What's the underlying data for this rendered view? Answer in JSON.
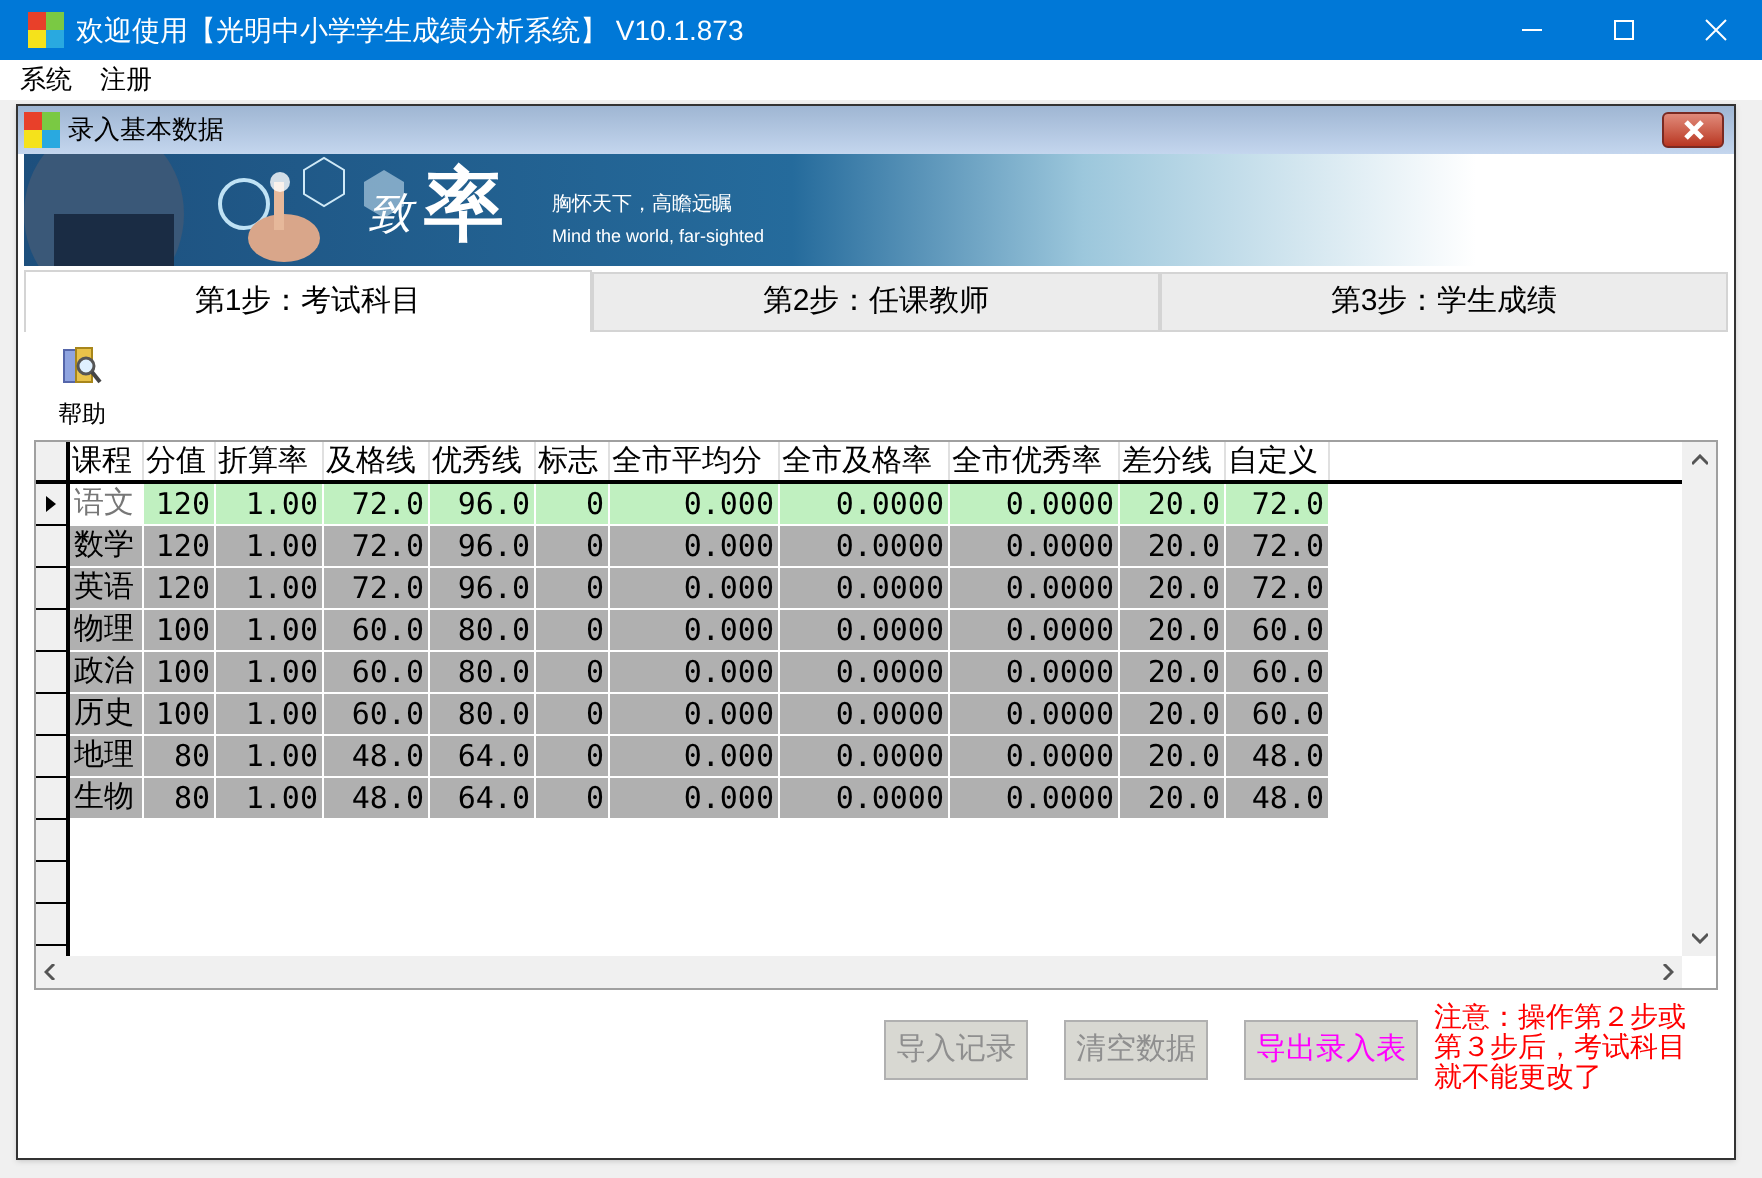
{
  "window": {
    "title": "欢迎使用【光明中小学学生成绩分析系统】 V10.1.873"
  },
  "menu": [
    "系统",
    "注册"
  ],
  "dialog": {
    "title": "录入基本数据"
  },
  "banner": {
    "brand_1": "致",
    "brand_2": "率",
    "slogan_cn": "胸怀天下，高瞻远瞩",
    "slogan_en": "Mind the world, far-sighted"
  },
  "tabs": [
    {
      "label": "第1步：考试科目",
      "selected": true
    },
    {
      "label": "第2步：任课教师",
      "selected": false
    },
    {
      "label": "第3步：学生成绩",
      "selected": false
    }
  ],
  "toolbar": [
    {
      "label": "帮助"
    }
  ],
  "table": {
    "columns": [
      "课程",
      "分值",
      "折算率",
      "及格线",
      "优秀线",
      "标志",
      "全市平均分",
      "全市及格率",
      "全市优秀率",
      "差分线",
      "自定义"
    ],
    "rows": [
      {
        "selected": true,
        "cells": [
          "语文",
          "120",
          "1.00",
          "72.0",
          "96.0",
          "0",
          "0.000",
          "0.0000",
          "0.0000",
          "20.0",
          "72.0"
        ]
      },
      {
        "selected": false,
        "cells": [
          "数学",
          "120",
          "1.00",
          "72.0",
          "96.0",
          "0",
          "0.000",
          "0.0000",
          "0.0000",
          "20.0",
          "72.0"
        ]
      },
      {
        "selected": false,
        "cells": [
          "英语",
          "120",
          "1.00",
          "72.0",
          "96.0",
          "0",
          "0.000",
          "0.0000",
          "0.0000",
          "20.0",
          "72.0"
        ]
      },
      {
        "selected": false,
        "cells": [
          "物理",
          "100",
          "1.00",
          "60.0",
          "80.0",
          "0",
          "0.000",
          "0.0000",
          "0.0000",
          "20.0",
          "60.0"
        ]
      },
      {
        "selected": false,
        "cells": [
          "政治",
          "100",
          "1.00",
          "60.0",
          "80.0",
          "0",
          "0.000",
          "0.0000",
          "0.0000",
          "20.0",
          "60.0"
        ]
      },
      {
        "selected": false,
        "cells": [
          "历史",
          "100",
          "1.00",
          "60.0",
          "80.0",
          "0",
          "0.000",
          "0.0000",
          "0.0000",
          "20.0",
          "60.0"
        ]
      },
      {
        "selected": false,
        "cells": [
          "地理",
          "80",
          "1.00",
          "48.0",
          "64.0",
          "0",
          "0.000",
          "0.0000",
          "0.0000",
          "20.0",
          "48.0"
        ]
      },
      {
        "selected": false,
        "cells": [
          "生物",
          "80",
          "1.00",
          "48.0",
          "64.0",
          "0",
          "0.000",
          "0.0000",
          "0.0000",
          "20.0",
          "48.0"
        ]
      }
    ]
  },
  "buttons": [
    {
      "label": "导入记录",
      "disabled": true
    },
    {
      "label": "清空数据",
      "disabled": true
    },
    {
      "label": "导出录入表",
      "disabled": false
    }
  ],
  "note": "注意：操作第２步或第３步后，考试科目就不能更改了"
}
